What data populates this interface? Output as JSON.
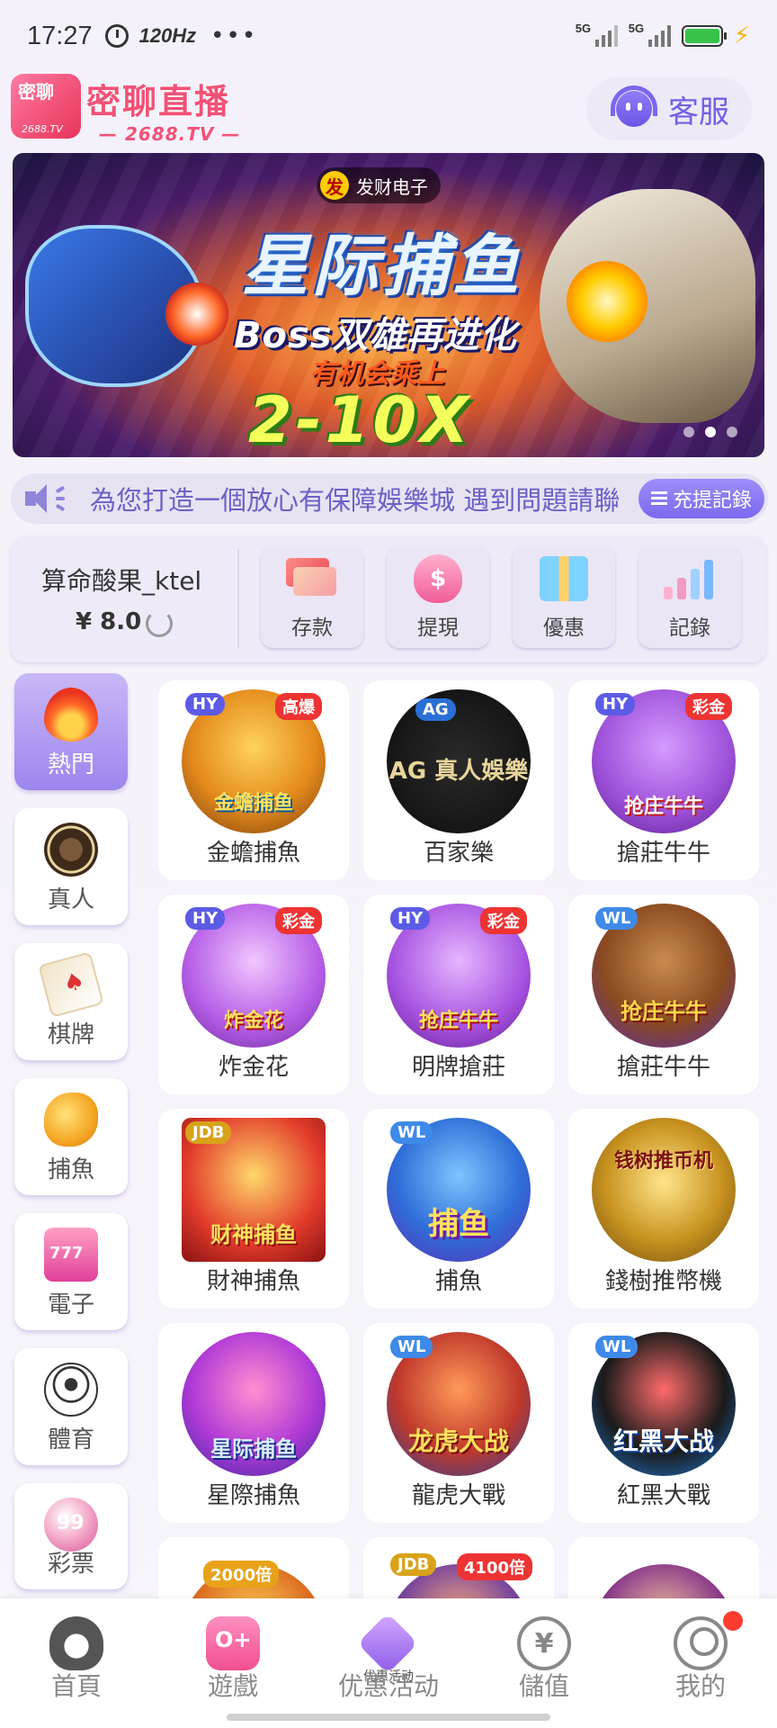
{
  "status_bar": {
    "time": "17:27",
    "refresh_rate": "120Hz",
    "more": "•••",
    "net1": "5G",
    "net2": "5G"
  },
  "header": {
    "logo_badge": "密聊",
    "logo_badge_url": "2688.TV",
    "logo_name": "密聊直播",
    "logo_url": "— 2688.TV —",
    "service_label": "客服"
  },
  "banner": {
    "brand": "发财电子",
    "brand_badge": "发",
    "title": "星际捕鱼",
    "line1": "Boss双雄再进化",
    "line2": "有机会乘上",
    "multiplier": "2-10X",
    "slide_count": 3,
    "active_slide": 2
  },
  "marquee": {
    "text": "為您打造一個放心有保障娛樂城  遇到問題請聯",
    "record_button": "充提記錄"
  },
  "wallet": {
    "username": "算命酸果_ktel",
    "balance": "¥ 8.0",
    "actions": [
      {
        "label": "存款",
        "icon": "card-icon"
      },
      {
        "label": "提現",
        "icon": "money-bag-icon"
      },
      {
        "label": "優惠",
        "icon": "gift-icon"
      },
      {
        "label": "記錄",
        "icon": "bar-chart-icon"
      }
    ]
  },
  "categories": [
    {
      "label": "熱門",
      "icon": "fire-icon",
      "active": true
    },
    {
      "label": "真人",
      "icon": "casino-chip-icon"
    },
    {
      "label": "棋牌",
      "icon": "playing-cards-icon"
    },
    {
      "label": "捕魚",
      "icon": "fish-icon"
    },
    {
      "label": "電子",
      "icon": "slot-machine-icon"
    },
    {
      "label": "體育",
      "icon": "soccer-ball-icon"
    },
    {
      "label": "彩票",
      "icon": "lottery-ball-icon"
    }
  ],
  "games": [
    {
      "label": "金蟾捕魚",
      "tag": "HY",
      "thumb_text": "金蟾捕鱼",
      "badge": "高爆"
    },
    {
      "label": "百家樂",
      "tag": "",
      "thumb_text": "AG 真人娛樂",
      "badge": "AG"
    },
    {
      "label": "搶莊牛牛",
      "tag": "HY",
      "thumb_text": "抢庄牛牛",
      "badge": "彩金"
    },
    {
      "label": "炸金花",
      "tag": "HY",
      "thumb_text": "炸金花",
      "badge": "彩金"
    },
    {
      "label": "明牌搶莊",
      "tag": "HY",
      "thumb_text": "抢庄牛牛",
      "badge": "彩金"
    },
    {
      "label": "搶莊牛牛",
      "tag": "WL",
      "thumb_text": "抢庄牛牛",
      "badge": ""
    },
    {
      "label": "財神捕魚",
      "tag": "JDB",
      "thumb_text": "财神捕鱼",
      "badge": ""
    },
    {
      "label": "捕魚",
      "tag": "WL",
      "thumb_text": "捕鱼",
      "badge": ""
    },
    {
      "label": "錢樹推幣機",
      "tag": "",
      "thumb_text": "钱树推币机",
      "badge": ""
    },
    {
      "label": "星際捕魚",
      "tag": "",
      "thumb_text": "星际捕鱼",
      "badge": ""
    },
    {
      "label": "龍虎大戰",
      "tag": "WL",
      "thumb_text": "龙虎大战",
      "badge": ""
    },
    {
      "label": "紅黑大戰",
      "tag": "WL",
      "thumb_text": "红黑大战",
      "badge": ""
    },
    {
      "label": "",
      "tag": "",
      "thumb_text": "",
      "badge": "2000倍"
    },
    {
      "label": "",
      "tag": "JDB",
      "thumb_text": "",
      "badge": "4100倍"
    },
    {
      "label": "",
      "tag": "",
      "thumb_text": "",
      "badge": ""
    }
  ],
  "bottom_nav": [
    {
      "label": "首頁",
      "icon": "home-avatar-icon"
    },
    {
      "label": "遊戲",
      "icon": "gamepad-icon"
    },
    {
      "label": "优惠活动",
      "icon": "promo-icon",
      "sub": "优惠活动"
    },
    {
      "label": "儲值",
      "icon": "yen-plus-icon"
    },
    {
      "label": "我的",
      "icon": "user-icon",
      "notification": true
    }
  ],
  "colors": {
    "accent": "#7b69ef",
    "brand_pink": "#f25277",
    "background": "#f4f1fa"
  }
}
